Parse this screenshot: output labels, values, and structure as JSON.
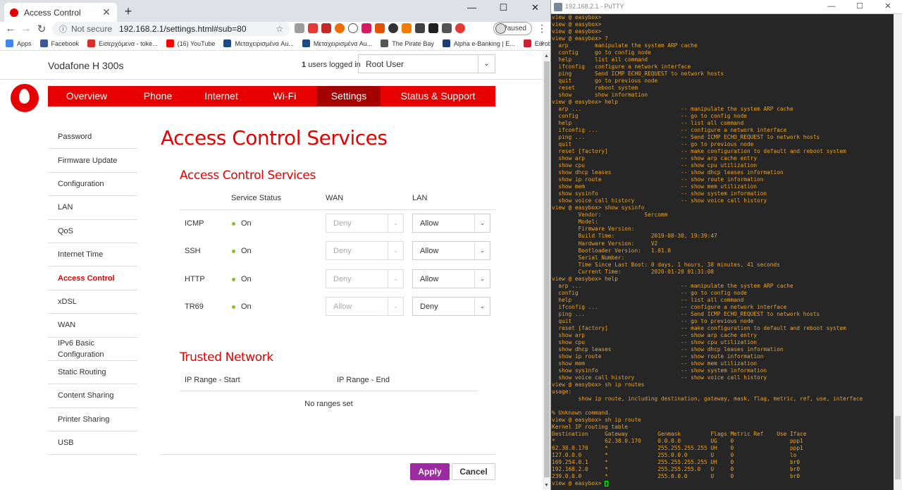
{
  "browser": {
    "tab_title": "Access Control",
    "tab_close": "✕",
    "new_tab": "+",
    "win_controls": [
      "—",
      "☐",
      "✕"
    ],
    "nav": {
      "back": "←",
      "forward": "→",
      "reload": "↻"
    },
    "security": "Not secure",
    "url": "192.168.2.1/settings.html#sub=80",
    "star": "☆",
    "profile_status": "Paused",
    "menu": "⋮",
    "bookmarks": [
      {
        "label": "Apps",
        "color": "#4285f4"
      },
      {
        "label": "Facebook",
        "color": "#3b5998"
      },
      {
        "label": "Εισερχόμενα - toke...",
        "color": "#d93025"
      },
      {
        "label": "(16) YouTube",
        "color": "#ff0000"
      },
      {
        "label": "Μεταχειρισμένα Au...",
        "color": "#1a4a8a"
      },
      {
        "label": "Μεταχειρισμένα Au...",
        "color": "#1a4a8a"
      },
      {
        "label": "The Pirate Bay",
        "color": "#555555"
      },
      {
        "label": "Alpha e-Banking | E...",
        "color": "#1f3b73"
      },
      {
        "label": "Eurobank",
        "color": "#d81b2c"
      }
    ],
    "bookmarks_more": "»"
  },
  "router": {
    "device_name": "Vodafone H 300s",
    "users_count": "1",
    "users_text": "users logged in",
    "user_select": "Root User",
    "nav": [
      "Overview",
      "Phone",
      "Internet",
      "Wi-Fi",
      "Settings",
      "Status & Support"
    ],
    "sidebar": [
      "Password",
      "Firmware Update",
      "Configuration",
      "LAN",
      "QoS",
      "Internet Time",
      "Access Control",
      "xDSL",
      "WAN",
      "IPv6 Basic Configuration",
      "Static Routing",
      "Content Sharing",
      "Printer Sharing",
      "USB"
    ],
    "page_title": "Access Control Services",
    "section_title": "Access Control Services",
    "columns": {
      "status": "Service Status",
      "wan": "WAN",
      "lan": "LAN"
    },
    "services": [
      {
        "name": "ICMP",
        "status": "On",
        "wan": "Deny",
        "lan": "Allow"
      },
      {
        "name": "SSH",
        "status": "On",
        "wan": "Deny",
        "lan": "Allow"
      },
      {
        "name": "HTTP",
        "status": "On",
        "wan": "Deny",
        "lan": "Allow"
      },
      {
        "name": "TR69",
        "status": "On",
        "wan": "Allow",
        "lan": "Deny"
      }
    ],
    "trusted_title": "Trusted Network",
    "trusted_cols": {
      "start": "IP Range - Start",
      "end": "IP Range - End"
    },
    "no_ranges": "No ranges set",
    "apply": "Apply",
    "cancel": "Cancel"
  },
  "putty": {
    "title": "192.168.2.1 - PuTTY",
    "win_controls": [
      "—",
      "☐",
      "✕"
    ],
    "terminal": "view @ easybox>\nview @ easybox>\nview @ easybox>\nview @ easybox> ?\n  arp        manipulate the system ARP cache\n  config     go to config node\n  help       list all command\n  ifconfig   configure a network interface\n  ping       Send ICMP ECHO_REQUEST to network hosts\n  quit       go to previous node\n  reset      reboot system\n  show       show information\nview @ easybox> help\n  arp ...                              -- manipulate the system ARP cache\n  config                               -- go to config node\n  help                                 -- list all command\n  ifconfig ...                         -- configure a network interface\n  ping ...                             -- Send ICMP ECHO_REQUEST to network hosts\n  quit                                 -- go to previous node\n  reset [factory]                      -- make configuration to default and reboot system\n  show arp                             -- show arp cache entry\n  show cpu                             -- show cpu utilization\n  show dhcp leases                     -- show dhcp leases information\n  show ip route                        -- show route information\n  show mem                             -- show mem utilization\n  show sysinfo                         -- show system information\n  show voice call history              -- show voice call history\nview @ easybox> show sysinfo\n        Vendor:             Sercomm\n        Model:\n        Firmware Version:\n        Build Time:           2019-08-30, 19:39:47\n        Hardware Version:     V2\n        Bootloader Version:   1.01.0\n        Serial Number:\n        Time Since Last Boot: 0 days, 1 hours, 38 minutes, 41 seconds\n        Current Time:         2020-01-20 01:31:08\nview @ easybox> help\n  arp ...                              -- manipulate the system ARP cache\n  config                               -- go to config node\n  help                                 -- list all command\n  ifconfig ...                         -- configure a network interface\n  ping ...                             -- Send ICMP ECHO_REQUEST to network hosts\n  quit                                 -- go to previous node\n  reset [factory]                      -- make configuration to default and reboot system\n  show arp                             -- show arp cache entry\n  show cpu                             -- show cpu utilization\n  show dhcp leases                     -- show dhcp leases information\n  show ip route                        -- show route information\n  show mem                             -- show mem utilization\n  show sysinfo                         -- show system information\n  show voice call history              -- show voice call history\nview @ easybox> sh ip routes\nusage:\n        show ip route, including destination, gateway, mask, flag, metric, ref, use, interface\n\n% Unknown command.\nview @ easybox> sh ip route\nKernel IP routing table\nDestination     Gateway         Genmask         Flags Metric Ref    Use Iface\n*               62.38.0.170     0.0.0.0         UG    0                 ppp1\n62.38.0.170     *               255.255.255.255 UH    0                 ppp1\n127.0.0.0       *               255.0.0.0       U     0                 lo\n169.254.0.1     *               255.255.255.255 UH    0                 br0\n192.168.2.0     *               255.255.255.0   U     0                 br0\n239.0.0.0       *               255.0.0.0       U     0                 br0",
    "prompt": "view @ easybox> "
  }
}
